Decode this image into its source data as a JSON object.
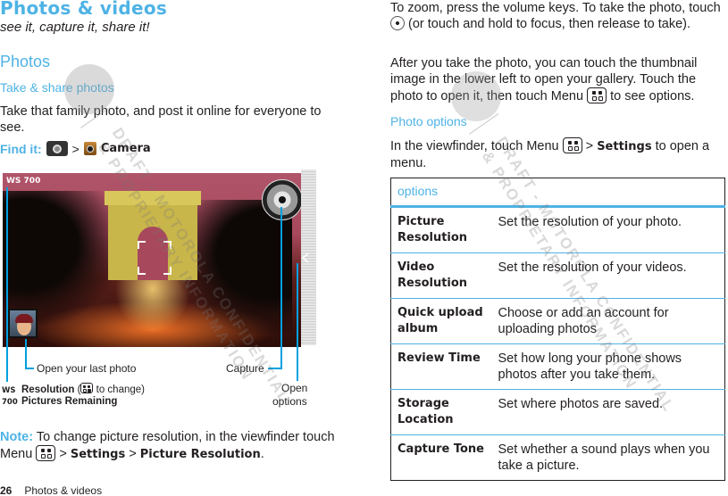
{
  "left_page": {
    "title": "Photos & videos",
    "subtitle": "see it, capture it, share it!",
    "section_heading": "Photos",
    "subsection_heading": "Take & share photos",
    "intro_text": "Take that family photo, and post it online for everyone to see.",
    "find_it": {
      "label": "Find it:",
      "separator": ">",
      "app_name": "Camera",
      "icons": [
        "apps-launcher-icon",
        "camera-app-icon"
      ]
    },
    "viewfinder": {
      "overlay_indicator": "WS 700",
      "callouts": {
        "open_last_photo": "Open your last photo",
        "capture": "Capture",
        "open_options_line1": "Open",
        "open_options_line2": "options"
      },
      "legend": [
        {
          "code": "WS",
          "label": "Resolution",
          "detail_prefix": " (",
          "detail_suffix": " to change)"
        },
        {
          "code": "700",
          "label": "Pictures Remaining"
        }
      ]
    },
    "note": {
      "label": "Note:",
      "text_1": " To change picture resolution, in the viewfinder touch Menu ",
      "sep": " > ",
      "settings": "Settings",
      "sep2": " > ",
      "picture_resolution": "Picture Resolution",
      "end": "."
    },
    "footer": {
      "page_number": "26",
      "section": "Photos & videos"
    }
  },
  "right_page": {
    "zoom_text_1": "To zoom, press the volume keys. To take the photo, touch ",
    "zoom_text_2": " (or touch and hold to focus, then release to take).",
    "after_text_1": "After you take the photo, you can touch the thumbnail image in the lower left to open your gallery. Touch the photo to open it, then touch Menu ",
    "after_text_2": " to see options.",
    "photo_options_heading": "Photo options",
    "viewfinder_text_1": "In the viewfinder, touch Menu ",
    "viewfinder_text_sep": " > ",
    "viewfinder_text_settings": "Settings",
    "viewfinder_text_2": " to open a menu.",
    "options_table": {
      "header": "options",
      "rows": [
        {
          "option": "Picture Resolution",
          "description": "Set the resolution of your photo."
        },
        {
          "option": "Video Resolution",
          "description": "Set the resolution of your videos."
        },
        {
          "option": "Quick upload album",
          "description": "Choose or add an account for uploading photos"
        },
        {
          "option": "Review Time",
          "description": "Set how long your phone shows photos after you take them."
        },
        {
          "option": "Storage Location",
          "description": "Set where photos are saved."
        },
        {
          "option": "Capture Tone",
          "description": "Set whether a sound plays when you take a picture."
        }
      ]
    }
  },
  "watermark": {
    "line1": "DRAFT - MOTOROLA CONFIDENTIAL",
    "line2": "& PROPRIETARY INFORMATION"
  },
  "colors": {
    "accent_blue": "#4eb3e5",
    "callout_blue": "#00a0e0",
    "text": "#231f20"
  }
}
